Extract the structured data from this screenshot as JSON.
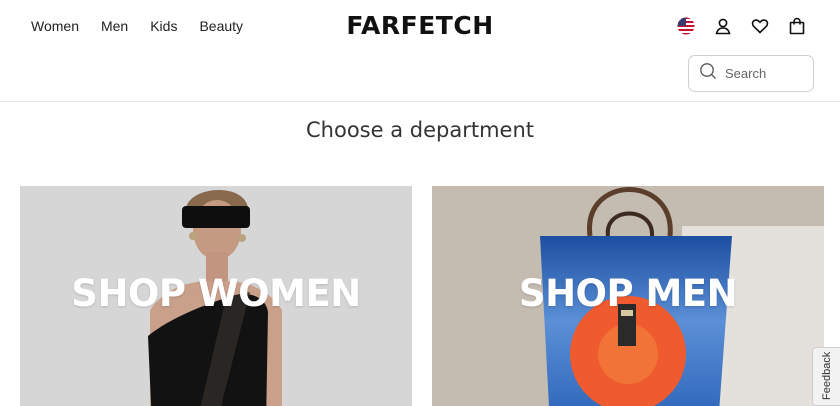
{
  "header": {
    "nav": [
      "Women",
      "Men",
      "Kids",
      "Beauty"
    ],
    "logo": "FARFETCH",
    "icons": [
      "us-flag-icon",
      "account-icon",
      "wishlist-heart-icon",
      "shopping-bag-icon"
    ],
    "search_placeholder": "Search"
  },
  "main": {
    "title": "Choose a department",
    "cards": [
      {
        "label": "SHOP WOMEN"
      },
      {
        "label": "SHOP MEN"
      }
    ]
  },
  "feedback": {
    "label": "Feedback"
  },
  "colors": {
    "text": "#222222",
    "border": "#e6e6e6",
    "card_label": "#ffffff"
  }
}
